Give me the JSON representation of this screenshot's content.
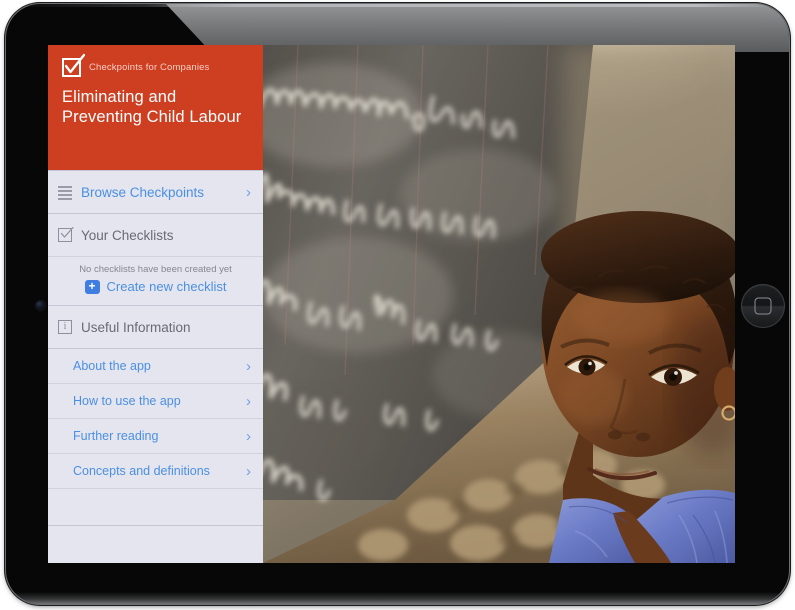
{
  "device": {
    "name": "tablet-device",
    "home_button": "home-button",
    "camera": "front-camera"
  },
  "toolbar": {
    "share_icon": "share-icon",
    "search_icon": "search-icon",
    "background_color": "#5b8fe0"
  },
  "brand": {
    "mark_icon": "checkbox-check-icon",
    "kicker": "Checkpoints for Companies",
    "title_line1": "Eliminating and",
    "title_line2": "Preventing Child Labour",
    "background_color": "#ce3e21",
    "text_color": "#ffffff"
  },
  "sidebar": {
    "background_color": "#e5e5ef",
    "link_color": "#4a90e2",
    "browse": {
      "icon": "list-icon",
      "label": "Browse Checkpoints",
      "chevron": "›"
    },
    "checklists_section": {
      "icon": "checkbox-icon",
      "label": "Your Checklists",
      "empty_note": "No checklists have been created yet",
      "create_plus": "+",
      "create_label": "Create new checklist"
    },
    "info_section": {
      "icon": "info-icon",
      "label": "Useful Information"
    },
    "info_items": [
      {
        "label": "About the app",
        "chevron": "›"
      },
      {
        "label": "How to use the app",
        "chevron": "›"
      },
      {
        "label": "Further reading",
        "chevron": "›"
      },
      {
        "label": "Concepts and definitions",
        "chevron": "›"
      }
    ]
  },
  "photo": {
    "name": "hero-photo",
    "description": "Child standing beside a chalkboard with French handwriting on a stone wall",
    "chalk_words": [
      "mouchoir, ano",
      "kadroit, malade",
      "aire, maladie, u",
      "ouvrir, chez",
      "ame"
    ]
  }
}
